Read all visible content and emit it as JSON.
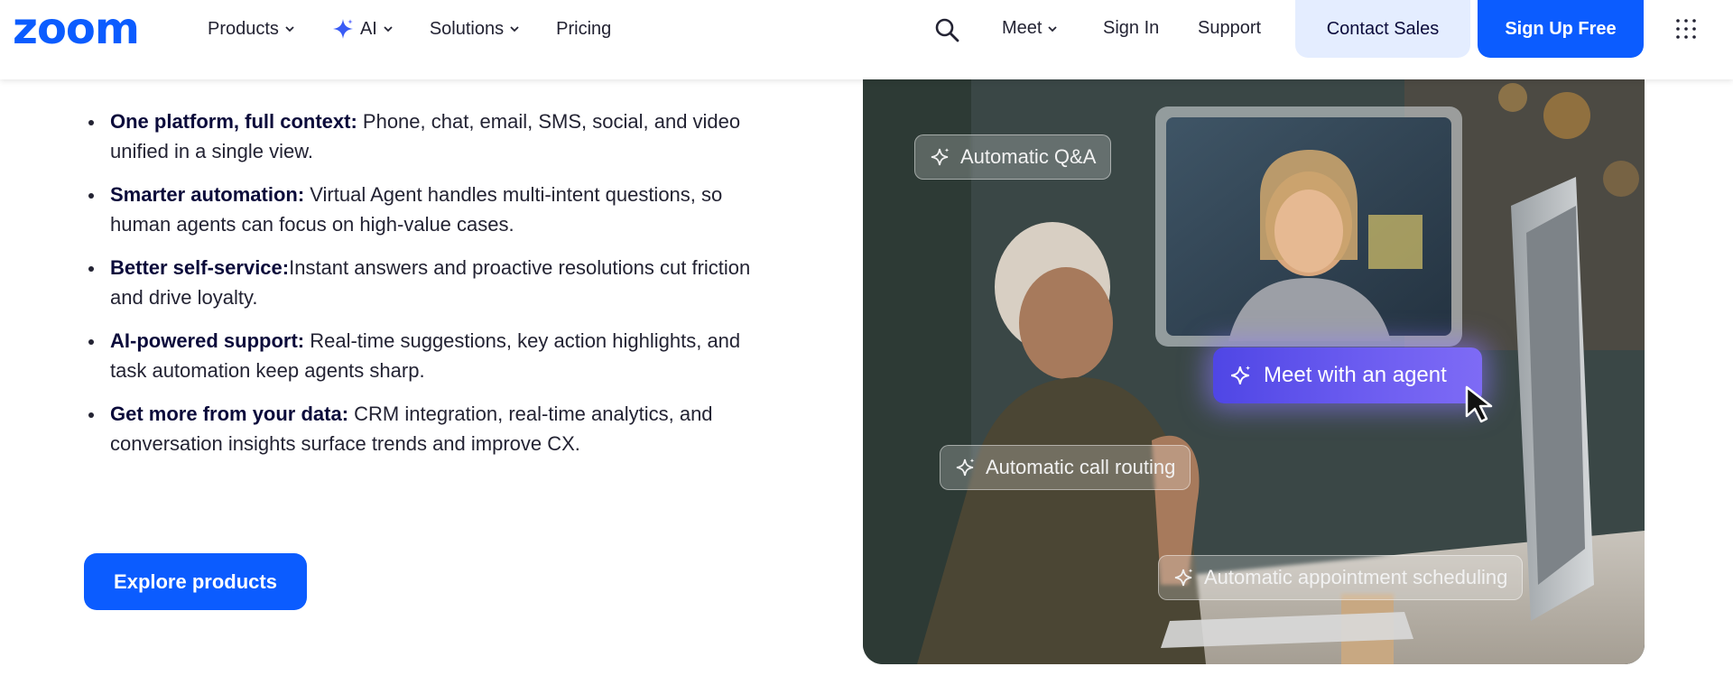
{
  "header": {
    "logo": "zoom",
    "nav": [
      {
        "label": "Products",
        "has_dropdown": true
      },
      {
        "label": "AI",
        "has_dropdown": true,
        "icon": "sparkle-icon"
      },
      {
        "label": "Solutions",
        "has_dropdown": true
      },
      {
        "label": "Pricing",
        "has_dropdown": false
      }
    ],
    "search_icon": "search-icon",
    "meet": "Meet",
    "sign_in": "Sign In",
    "support": "Support",
    "contact_sales": "Contact Sales",
    "sign_up": "Sign Up Free",
    "apps_icon": "grid-icon"
  },
  "features": [
    {
      "title": "One platform, full context:",
      "text": " Phone, chat, email, SMS, social, and video unified in a single view."
    },
    {
      "title": "Smarter automation:",
      "text": " Virtual Agent handles multi-intent questions, so human agents can focus on high-value cases."
    },
    {
      "title": "Better self-service:",
      "text": "Instant answers and proactive resolutions cut friction and drive loyalty."
    },
    {
      "title": "AI-powered support:",
      "text": " Real-time suggestions, key action highlights, and task automation keep agents sharp."
    },
    {
      "title": "Get more from your data:",
      "text": " CRM integration, real-time analytics, and conversation insights surface trends and improve CX."
    }
  ],
  "cta": {
    "explore": "Explore products"
  },
  "hero": {
    "chips": {
      "qa": "Automatic Q&A",
      "meet_agent": "Meet with an agent",
      "call_routing": "Automatic call routing",
      "scheduling": "Automatic appointment scheduling"
    }
  },
  "colors": {
    "brand_blue": "#0b5cff",
    "contact_bg": "#e4edff",
    "text_dark": "#0b0b3b"
  }
}
